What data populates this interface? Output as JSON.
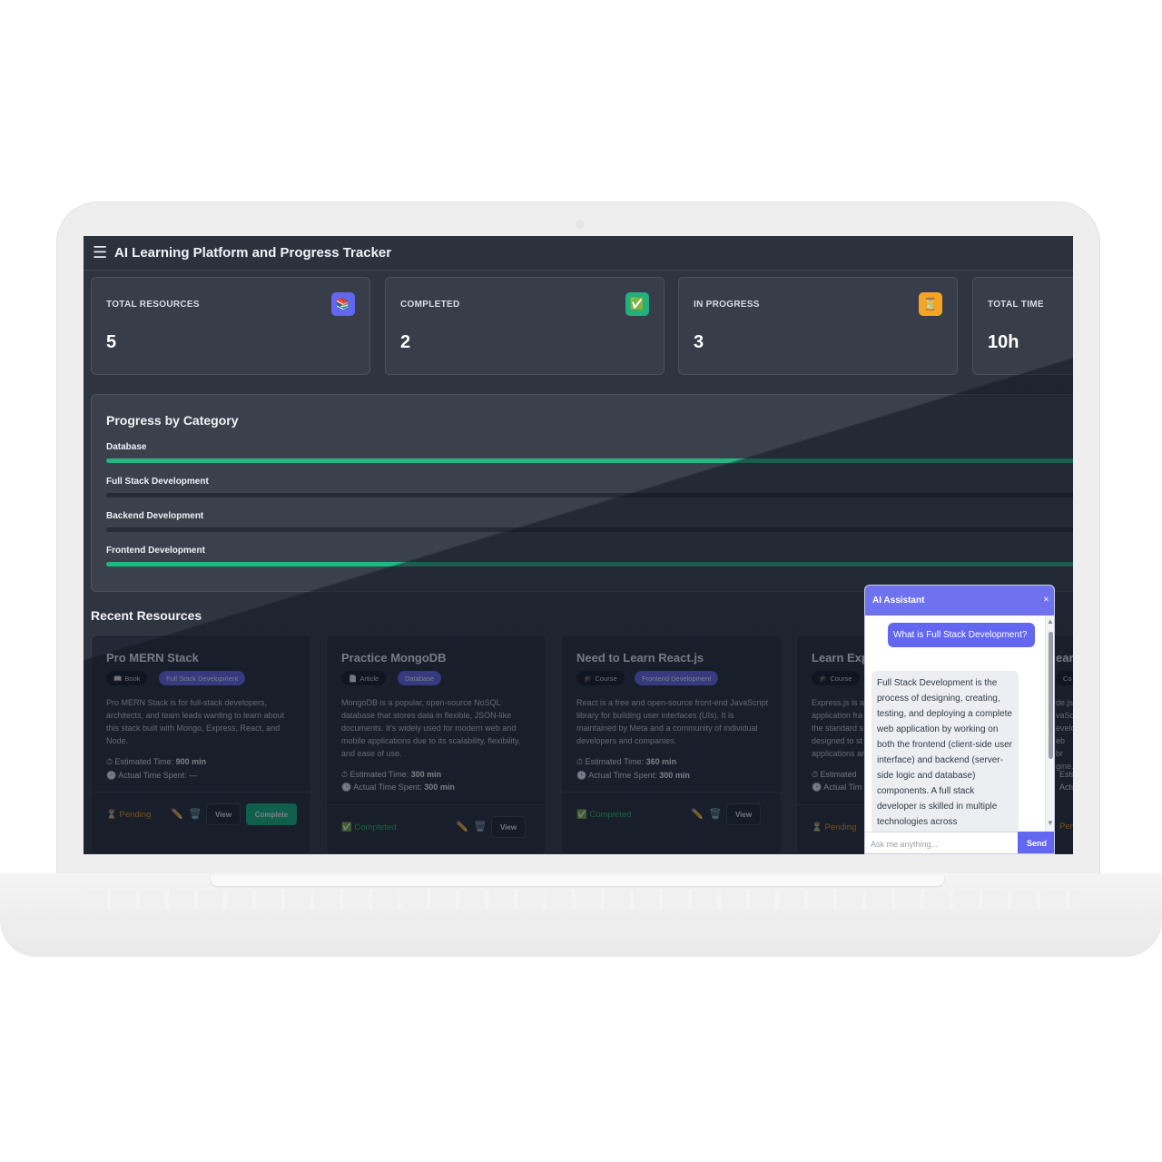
{
  "header": {
    "menu_icon": "hamburger-icon",
    "menu_glyph": "☰",
    "title": "AI Learning Platform and Progress Tracker"
  },
  "stats": [
    {
      "label": "TOTAL RESOURCES",
      "value": "5",
      "icon": "books-icon",
      "glyph": "📚",
      "color": "#6366f1"
    },
    {
      "label": "COMPLETED",
      "value": "2",
      "icon": "check-icon",
      "glyph": "✅",
      "color": "#22b07d"
    },
    {
      "label": "IN PROGRESS",
      "value": "3",
      "icon": "hourglass-icon",
      "glyph": "⏳",
      "color": "#f5a524"
    },
    {
      "label": "TOTAL TIME",
      "value": "10h"
    }
  ],
  "progress": {
    "title": "Progress by Category",
    "categories": [
      {
        "name": "Database",
        "progress": 1.0
      },
      {
        "name": "Full Stack Development",
        "progress": 0.0
      },
      {
        "name": "Backend Development",
        "progress": 0.0
      },
      {
        "name": "Frontend Development",
        "progress": 1.0
      }
    ]
  },
  "recent": {
    "title": "Recent Resources",
    "cards": [
      {
        "title": "Pro MERN Stack",
        "type_icon": "📖",
        "type": "Book",
        "category": "Full Stack Development",
        "description": "Pro MERN Stack is for full-stack developers, architects, and team leads wanting to learn about this stack built with Mongo, Express, React, and Node.",
        "est_label": "Estimated Time:",
        "est_value": "900 min",
        "act_label": "Actual Time Spent:",
        "act_value": "—",
        "status_icon": "⏳",
        "status": "Pending",
        "view_label": "View",
        "complete_label": "Complete"
      },
      {
        "title": "Practice MongoDB",
        "type_icon": "📄",
        "type": "Article",
        "category": "Database",
        "description": "MongoDB is a popular, open-source NoSQL database that stores data in flexible, JSON-like documents. It's widely used for modern web and mobile applications due to its scalability, flexibility, and ease of use.",
        "est_label": "Estimated Time:",
        "est_value": "300 min",
        "act_label": "Actual Time Spent:",
        "act_value": "300 min",
        "status_icon": "✅",
        "status": "Completed",
        "view_label": "View"
      },
      {
        "title": "Need to Learn React.js",
        "type_icon": "🎓",
        "type": "Course",
        "category": "Frontend Development",
        "description": "React is a free and open-source front-end JavaScript library for building user interfaces (UIs). It is maintained by Meta and a community of individual developers and companies.",
        "est_label": "Estimated Time:",
        "est_value": "360 min",
        "act_label": "Actual Time Spent:",
        "act_value": "300 min",
        "status_icon": "✅",
        "status": "Completed",
        "view_label": "View"
      },
      {
        "title": "Learn Expr",
        "type_icon": "🎓",
        "type": "Course",
        "description": "Express.js is a application fra the standard s designed to st applications ar",
        "est_label": "Estimated",
        "act_label": "Actual Tim",
        "status_icon": "⏳",
        "status": "Pending"
      },
      {
        "title": "earn",
        "type": "Co",
        "description": "de.js vaScri evelo eb br gine.",
        "est_label": "Esti",
        "act_label": "Actu",
        "status": "Per"
      }
    ],
    "edit_icon": "✏️",
    "delete_icon": "🗑️",
    "clock_icon": "⏱",
    "timer_icon": "🕒"
  },
  "assistant": {
    "title": "AI Assistant",
    "close": "×",
    "user_message": "What is Full Stack Development?",
    "bot_message": "Full Stack Development is the process of designing, creating, testing, and deploying a complete web application by working on both the frontend (client-side user interface) and backend (server-side logic and database) components. A full stack developer is skilled in multiple technologies across",
    "input_placeholder": "Ask me anything...",
    "send_label": "Send"
  },
  "colors": {
    "accent": "#6366f1",
    "success": "#10b981",
    "warning": "#f59e0b"
  }
}
